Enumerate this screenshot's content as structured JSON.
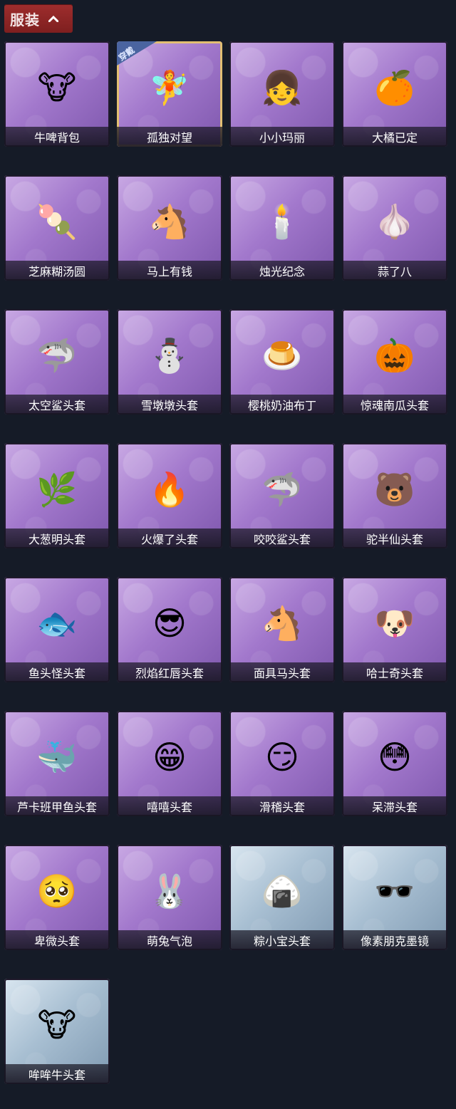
{
  "header": {
    "title": "服装",
    "toggle_icon": "chevron-up-icon"
  },
  "badges": {
    "equipped": "穿戴"
  },
  "items": [
    {
      "label": "牛啤背包",
      "icon": "🐮",
      "theme": "purple"
    },
    {
      "label": "孤独对望",
      "icon": "🧚",
      "theme": "purple",
      "selected": true
    },
    {
      "label": "小小玛丽",
      "icon": "👧",
      "theme": "purple"
    },
    {
      "label": "大橘已定",
      "icon": "🍊",
      "theme": "purple"
    },
    {
      "label": "芝麻糊汤圆",
      "icon": "🍡",
      "theme": "purple"
    },
    {
      "label": "马上有钱",
      "icon": "🐴",
      "theme": "purple"
    },
    {
      "label": "烛光纪念",
      "icon": "🕯️",
      "theme": "purple"
    },
    {
      "label": "蒜了八",
      "icon": "🧄",
      "theme": "purple"
    },
    {
      "label": "太空鲨头套",
      "icon": "🦈",
      "theme": "purple"
    },
    {
      "label": "雪墩墩头套",
      "icon": "⛄",
      "theme": "purple"
    },
    {
      "label": "樱桃奶油布丁",
      "icon": "🍮",
      "theme": "purple"
    },
    {
      "label": "惊魂南瓜头套",
      "icon": "🎃",
      "theme": "purple"
    },
    {
      "label": "大葱明头套",
      "icon": "🌿",
      "theme": "purple"
    },
    {
      "label": "火爆了头套",
      "icon": "🔥",
      "theme": "purple"
    },
    {
      "label": "咬咬鲨头套",
      "icon": "🦈",
      "theme": "purple"
    },
    {
      "label": "驼半仙头套",
      "icon": "🐻",
      "theme": "purple"
    },
    {
      "label": "鱼头怪头套",
      "icon": "🐟",
      "theme": "purple"
    },
    {
      "label": "烈焰红唇头套",
      "icon": "😎",
      "theme": "purple"
    },
    {
      "label": "面具马头套",
      "icon": "🐴",
      "theme": "purple"
    },
    {
      "label": "哈士奇头套",
      "icon": "🐶",
      "theme": "purple"
    },
    {
      "label": "芦卡班甲鱼头套",
      "icon": "🐳",
      "theme": "purple"
    },
    {
      "label": "嘻嘻头套",
      "icon": "😁",
      "theme": "purple"
    },
    {
      "label": "滑稽头套",
      "icon": "😏",
      "theme": "purple"
    },
    {
      "label": "呆滞头套",
      "icon": "😳",
      "theme": "purple"
    },
    {
      "label": "卑微头套",
      "icon": "🥺",
      "theme": "purple"
    },
    {
      "label": "萌兔气泡",
      "icon": "🐰",
      "theme": "purple"
    },
    {
      "label": "粽小宝头套",
      "icon": "🍙",
      "theme": "blue"
    },
    {
      "label": "像素朋克墨镜",
      "icon": "🕶️",
      "theme": "blue"
    },
    {
      "label": "哞哞牛头套",
      "icon": "🐮",
      "theme": "blue"
    }
  ]
}
